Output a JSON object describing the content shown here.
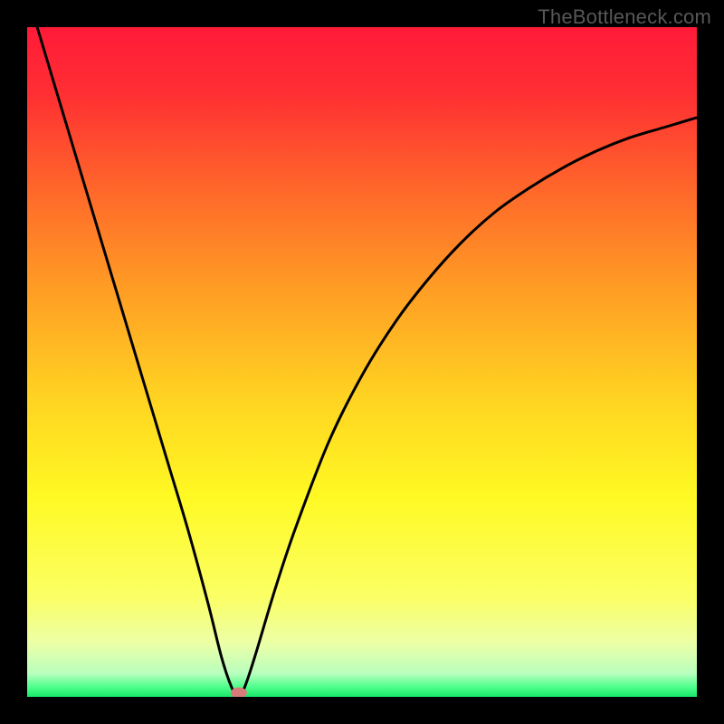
{
  "watermark": "TheBottleneck.com",
  "chart_data": {
    "type": "line",
    "title": "",
    "xlabel": "",
    "ylabel": "",
    "xlim": [
      0,
      100
    ],
    "ylim": [
      0,
      100
    ],
    "x": [
      0,
      3,
      6,
      9,
      12,
      15,
      18,
      21,
      24,
      27,
      29,
      30.5,
      31.5,
      32.5,
      34,
      37,
      40,
      45,
      50,
      55,
      60,
      65,
      70,
      75,
      80,
      85,
      90,
      95,
      100
    ],
    "values": [
      105,
      95,
      85,
      75,
      65,
      55,
      45,
      35,
      25,
      14,
      6,
      1.5,
      0,
      1.5,
      6,
      16,
      25,
      38,
      48,
      56,
      62.5,
      68,
      72.5,
      76,
      79,
      81.5,
      83.5,
      85,
      86.5
    ],
    "marker": {
      "x": 31.6,
      "y": 0.6
    },
    "gradient_stops": [
      {
        "offset": 0.0,
        "color": "#ff1a38"
      },
      {
        "offset": 0.1,
        "color": "#ff2f33"
      },
      {
        "offset": 0.25,
        "color": "#ff6a2a"
      },
      {
        "offset": 0.4,
        "color": "#ffa024"
      },
      {
        "offset": 0.55,
        "color": "#ffd222"
      },
      {
        "offset": 0.7,
        "color": "#fff923"
      },
      {
        "offset": 0.85,
        "color": "#fbff64"
      },
      {
        "offset": 0.92,
        "color": "#ecffa7"
      },
      {
        "offset": 0.965,
        "color": "#b9ffbe"
      },
      {
        "offset": 0.985,
        "color": "#4fff8c"
      },
      {
        "offset": 1.0,
        "color": "#17e86a"
      }
    ],
    "curve_color": "#000000",
    "curve_width": 3,
    "marker_color": "#d77b7b"
  }
}
